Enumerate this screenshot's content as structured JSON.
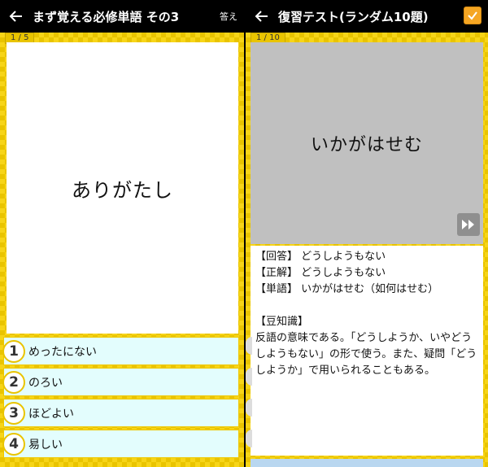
{
  "left_screen": {
    "title": "まず覚える必修単語 その3",
    "answer_label": "答え",
    "counter": "1 / 5",
    "question_word": "ありがたし",
    "choices": [
      {
        "num": "1",
        "text": "めったにない"
      },
      {
        "num": "2",
        "text": "のろい"
      },
      {
        "num": "3",
        "text": "ほどよい"
      },
      {
        "num": "4",
        "text": "易しい"
      }
    ]
  },
  "right_screen": {
    "title": "復習テスト(ランダム10題)",
    "counter": "1 / 10",
    "word": "いかがはせむ",
    "result": {
      "answer": "【回答】 どうしようもない",
      "correct": "【正解】 どうしようもない",
      "word": "【単語】 いかがはせむ（如何はせむ）",
      "trivia_label": "【豆知識】",
      "trivia": "反語の意味である。「どうしようか、いやどうしようもない」の形で使う。また、疑問「どうしようか」で用いられることもある。"
    }
  },
  "icons": {
    "back": "arrow-left-icon",
    "check": "checkmark-icon",
    "skip": "fast-forward-icon"
  },
  "colors": {
    "accent_yellow": "#f5d20a",
    "choice_bg": "#e3fdfd",
    "check_orange": "#f5a623"
  }
}
